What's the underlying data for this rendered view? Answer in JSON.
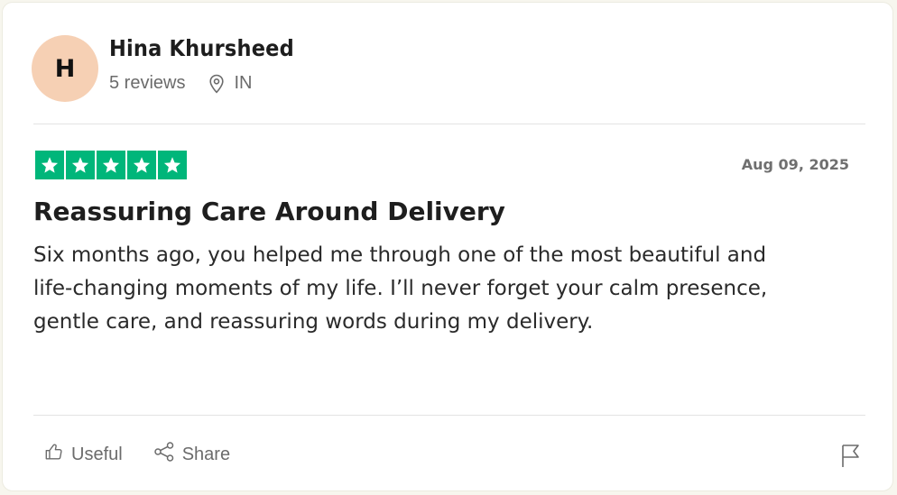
{
  "reviewer": {
    "initial": "H",
    "name": "Hina Khursheed",
    "reviews": "5 reviews",
    "location": "IN"
  },
  "rating": {
    "stars": 5,
    "max": 5,
    "color": "#00b67a"
  },
  "review": {
    "date": "Aug 09, 2025",
    "title": "Reassuring Care Around Delivery",
    "body_lines": [
      "Six months ago, you helped me through one of the most beautiful and",
      "life-changing moments of my life. I’ll never forget your calm presence,",
      "gentle care, and reassuring words during my delivery."
    ]
  },
  "actions": {
    "useful": "Useful",
    "share": "Share",
    "icons": [
      "thumbs-up-icon",
      "share-icon",
      "flag-icon"
    ]
  },
  "colors": {
    "avatar_bg": "#f6d0b4",
    "star_bg": "#00b67a"
  }
}
